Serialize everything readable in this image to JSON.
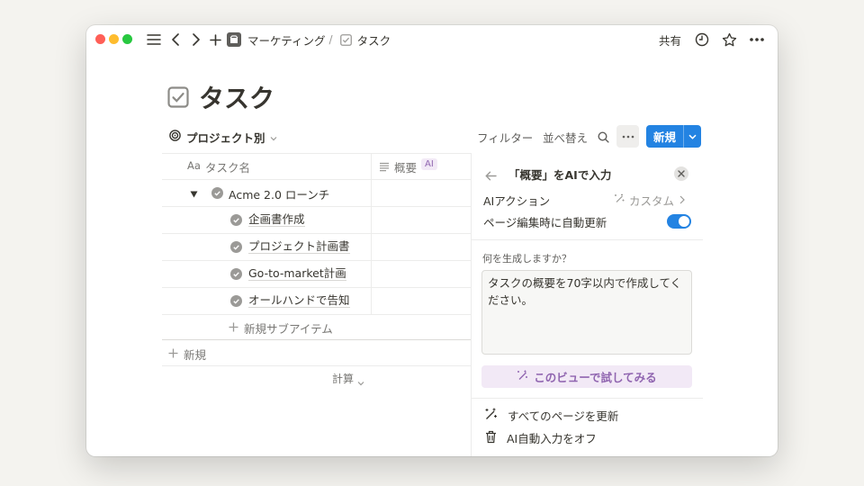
{
  "colors": {
    "close_dot": "#ff5f57",
    "minimize_dot": "#febc2e",
    "zoom_dot": "#28c840",
    "accent": "#2383e2",
    "ai_purple": "#9065b0"
  },
  "titlebar": {
    "icons": [
      "sidebar-menu-icon",
      "back-arrow-icon",
      "forward-arrow-icon",
      "plus-icon"
    ],
    "breadcrumb": {
      "parent": "マーケティング",
      "separator": "/",
      "current": "タスク"
    },
    "share_label": "共有",
    "right_icons": [
      "history-clock-icon",
      "favorite-star-icon",
      "more-dots-icon"
    ]
  },
  "page": {
    "title": "タスク"
  },
  "viewbar": {
    "view_name": "プロジェクト別",
    "filter_label": "フィルター",
    "sort_label": "並べ替え",
    "new_label": "新規"
  },
  "table": {
    "columns": {
      "name_prefix": "Aa",
      "name": "タスク名",
      "summary": "概要",
      "ai_badge": "AI"
    },
    "parent_row": "Acme 2.0 ローンチ",
    "subitems": [
      "企画書作成",
      "プロジェクト計画書",
      "Go-to-market計画",
      "オールハンドで告知"
    ],
    "new_subitem_label": "新規サブアイテム",
    "new_row_label": "新規",
    "calculate_label": "計算"
  },
  "ai_panel": {
    "title": "「概要」をAIで入力",
    "action_label": "AIアクション",
    "action_value": "カスタム",
    "auto_update_label": "ページ編集時に自動更新",
    "auto_update_on": true,
    "prompt_label": "何を生成しますか？",
    "prompt_value": "タスクの概要を70字以内で作成してください。",
    "try_label": "このビューで試してみる",
    "update_all_label": "すべてのページを更新",
    "turn_off_label": "AI自動入力をオフ"
  }
}
